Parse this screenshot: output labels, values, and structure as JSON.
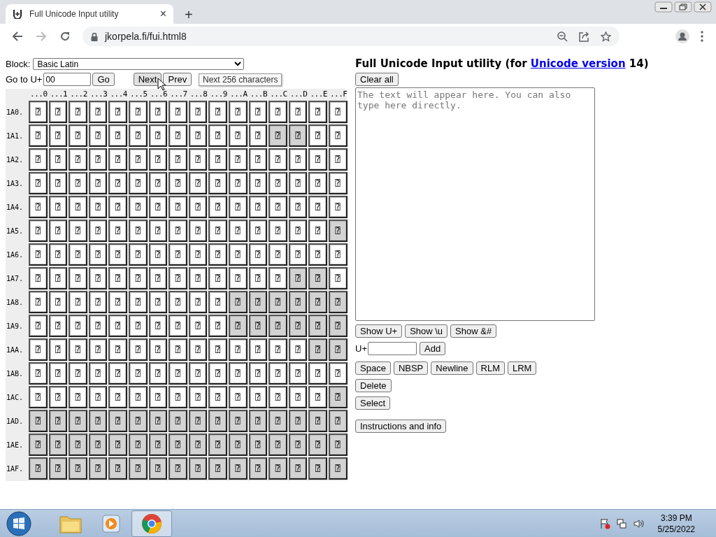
{
  "browser": {
    "tab_title": "Full Unicode Input utility",
    "tab_close": "×",
    "new_tab": "+",
    "url": "jkorpela.fi/fui.html8"
  },
  "controls": {
    "block_label": "Block:",
    "block_value": "Basic Latin",
    "goto_label": "Go to U+",
    "goto_value": "00",
    "buttons": [
      {
        "label": "Go",
        "hovered": false
      },
      {
        "label": "Next",
        "hovered": true
      },
      {
        "label": "Prev",
        "hovered": false
      }
    ],
    "tooltip": "Next 256 characters"
  },
  "grid": {
    "columns": [
      "...0",
      "...1",
      "...2",
      "...3",
      "...4",
      "...5",
      "...6",
      "...7",
      "...8",
      "...9",
      "...A",
      "...B",
      "...C",
      "...D",
      "...E",
      "...F"
    ],
    "rows": [
      {
        "label": "1A0.",
        "cells": [
          {
            "glyph": "⍰",
            "assigned": true
          },
          {
            "glyph": "⍰",
            "assigned": true
          },
          {
            "glyph": "⍰",
            "assigned": true
          },
          {
            "glyph": "⍰",
            "assigned": true
          },
          {
            "glyph": "⍰",
            "assigned": true
          },
          {
            "glyph": "⍰",
            "assigned": true
          },
          {
            "glyph": "⍰",
            "assigned": true
          },
          {
            "glyph": "⍰",
            "assigned": true
          },
          {
            "glyph": "⍰",
            "assigned": true
          },
          {
            "glyph": "⍰",
            "assigned": true
          },
          {
            "glyph": "⍰",
            "assigned": true
          },
          {
            "glyph": "⍰",
            "assigned": true
          },
          {
            "glyph": "⍰",
            "assigned": true
          },
          {
            "glyph": "⍰",
            "assigned": true
          },
          {
            "glyph": "⍰",
            "assigned": true
          },
          {
            "glyph": "⍰",
            "assigned": true
          }
        ]
      },
      {
        "label": "1A1.",
        "cells": [
          {
            "glyph": "⍰",
            "assigned": true
          },
          {
            "glyph": "⍰",
            "assigned": true
          },
          {
            "glyph": "⍰",
            "assigned": true
          },
          {
            "glyph": "⍰",
            "assigned": true
          },
          {
            "glyph": "⍰",
            "assigned": true
          },
          {
            "glyph": "⍰",
            "assigned": true
          },
          {
            "glyph": "⍰",
            "assigned": true
          },
          {
            "glyph": "⍰",
            "assigned": true
          },
          {
            "glyph": "⍰",
            "assigned": true
          },
          {
            "glyph": "⍰",
            "assigned": true
          },
          {
            "glyph": "⍰",
            "assigned": true
          },
          {
            "glyph": "⍰",
            "assigned": true
          },
          {
            "glyph": "⍰",
            "assigned": false
          },
          {
            "glyph": "⍰",
            "assigned": false
          },
          {
            "glyph": "⍰",
            "assigned": true
          },
          {
            "glyph": "⍰",
            "assigned": true
          }
        ]
      },
      {
        "label": "1A2.",
        "cells": [
          {
            "glyph": "⍰",
            "assigned": true
          },
          {
            "glyph": "⍰",
            "assigned": true
          },
          {
            "glyph": "⍰",
            "assigned": true
          },
          {
            "glyph": "⍰",
            "assigned": true
          },
          {
            "glyph": "⍰",
            "assigned": true
          },
          {
            "glyph": "⍰",
            "assigned": true
          },
          {
            "glyph": "⍰",
            "assigned": true
          },
          {
            "glyph": "⍰",
            "assigned": true
          },
          {
            "glyph": "⍰",
            "assigned": true
          },
          {
            "glyph": "⍰",
            "assigned": true
          },
          {
            "glyph": "⍰",
            "assigned": true
          },
          {
            "glyph": "⍰",
            "assigned": true
          },
          {
            "glyph": "⍰",
            "assigned": true
          },
          {
            "glyph": "⍰",
            "assigned": true
          },
          {
            "glyph": "⍰",
            "assigned": true
          },
          {
            "glyph": "⍰",
            "assigned": true
          }
        ]
      },
      {
        "label": "1A3.",
        "cells": [
          {
            "glyph": "⍰",
            "assigned": true
          },
          {
            "glyph": "⍰",
            "assigned": true
          },
          {
            "glyph": "⍰",
            "assigned": true
          },
          {
            "glyph": "⍰",
            "assigned": true
          },
          {
            "glyph": "⍰",
            "assigned": true
          },
          {
            "glyph": "⍰",
            "assigned": true
          },
          {
            "glyph": "⍰",
            "assigned": true
          },
          {
            "glyph": "⍰",
            "assigned": true
          },
          {
            "glyph": "⍰",
            "assigned": true
          },
          {
            "glyph": "⍰",
            "assigned": true
          },
          {
            "glyph": "⍰",
            "assigned": true
          },
          {
            "glyph": "⍰",
            "assigned": true
          },
          {
            "glyph": "⍰",
            "assigned": true
          },
          {
            "glyph": "⍰",
            "assigned": true
          },
          {
            "glyph": "⍰",
            "assigned": true
          },
          {
            "glyph": "⍰",
            "assigned": true
          }
        ]
      },
      {
        "label": "1A4.",
        "cells": [
          {
            "glyph": "⍰",
            "assigned": true
          },
          {
            "glyph": "⍰",
            "assigned": true
          },
          {
            "glyph": "⍰",
            "assigned": true
          },
          {
            "glyph": "⍰",
            "assigned": true
          },
          {
            "glyph": "⍰",
            "assigned": true
          },
          {
            "glyph": "⍰",
            "assigned": true
          },
          {
            "glyph": "⍰",
            "assigned": true
          },
          {
            "glyph": "⍰",
            "assigned": true
          },
          {
            "glyph": "⍰",
            "assigned": true
          },
          {
            "glyph": "⍰",
            "assigned": true
          },
          {
            "glyph": "⍰",
            "assigned": true
          },
          {
            "glyph": "⍰",
            "assigned": true
          },
          {
            "glyph": "⍰",
            "assigned": true
          },
          {
            "glyph": "⍰",
            "assigned": true
          },
          {
            "glyph": "⍰",
            "assigned": true
          },
          {
            "glyph": "⍰",
            "assigned": true
          }
        ]
      },
      {
        "label": "1A5.",
        "cells": [
          {
            "glyph": "⍰",
            "assigned": true
          },
          {
            "glyph": "⍰",
            "assigned": true
          },
          {
            "glyph": "⍰",
            "assigned": true
          },
          {
            "glyph": "⍰",
            "assigned": true
          },
          {
            "glyph": "⍰",
            "assigned": true
          },
          {
            "glyph": "⍰",
            "assigned": true
          },
          {
            "glyph": "⍰",
            "assigned": true
          },
          {
            "glyph": "⍰",
            "assigned": true
          },
          {
            "glyph": "⍰",
            "assigned": true
          },
          {
            "glyph": "⍰",
            "assigned": true
          },
          {
            "glyph": "⍰",
            "assigned": true
          },
          {
            "glyph": "⍰",
            "assigned": true
          },
          {
            "glyph": "⍰",
            "assigned": true
          },
          {
            "glyph": "⍰",
            "assigned": true
          },
          {
            "glyph": "⍰",
            "assigned": true
          },
          {
            "glyph": "⍰",
            "assigned": false
          }
        ]
      },
      {
        "label": "1A6.",
        "cells": [
          {
            "glyph": "⍰",
            "assigned": true
          },
          {
            "glyph": "⍰",
            "assigned": true
          },
          {
            "glyph": "⍰",
            "assigned": true
          },
          {
            "glyph": "⍰",
            "assigned": true
          },
          {
            "glyph": "⍰",
            "assigned": true
          },
          {
            "glyph": "⍰",
            "assigned": true
          },
          {
            "glyph": "⍰",
            "assigned": true
          },
          {
            "glyph": "⍰",
            "assigned": true
          },
          {
            "glyph": "⍰",
            "assigned": true
          },
          {
            "glyph": "⍰",
            "assigned": true
          },
          {
            "glyph": "⍰",
            "assigned": true
          },
          {
            "glyph": "⍰",
            "assigned": true
          },
          {
            "glyph": "⍰",
            "assigned": true
          },
          {
            "glyph": "⍰",
            "assigned": true
          },
          {
            "glyph": "⍰",
            "assigned": true
          },
          {
            "glyph": "⍰",
            "assigned": true
          }
        ]
      },
      {
        "label": "1A7.",
        "cells": [
          {
            "glyph": "⍰",
            "assigned": true
          },
          {
            "glyph": "⍰",
            "assigned": true
          },
          {
            "glyph": "⍰",
            "assigned": true
          },
          {
            "glyph": "⍰",
            "assigned": true
          },
          {
            "glyph": "⍰",
            "assigned": true
          },
          {
            "glyph": "⍰",
            "assigned": true
          },
          {
            "glyph": "⍰",
            "assigned": true
          },
          {
            "glyph": "⍰",
            "assigned": true
          },
          {
            "glyph": "⍰",
            "assigned": true
          },
          {
            "glyph": "⍰",
            "assigned": true
          },
          {
            "glyph": "⍰",
            "assigned": true
          },
          {
            "glyph": "⍰",
            "assigned": true
          },
          {
            "glyph": "⍰",
            "assigned": true
          },
          {
            "glyph": "⍰",
            "assigned": false
          },
          {
            "glyph": "⍰",
            "assigned": false
          },
          {
            "glyph": "⍰",
            "assigned": true
          }
        ]
      },
      {
        "label": "1A8.",
        "cells": [
          {
            "glyph": "⍰",
            "assigned": true
          },
          {
            "glyph": "⍰",
            "assigned": true
          },
          {
            "glyph": "⍰",
            "assigned": true
          },
          {
            "glyph": "⍰",
            "assigned": true
          },
          {
            "glyph": "⍰",
            "assigned": true
          },
          {
            "glyph": "⍰",
            "assigned": true
          },
          {
            "glyph": "⍰",
            "assigned": true
          },
          {
            "glyph": "⍰",
            "assigned": true
          },
          {
            "glyph": "⍰",
            "assigned": true
          },
          {
            "glyph": "⍰",
            "assigned": true
          },
          {
            "glyph": "⍰",
            "assigned": false
          },
          {
            "glyph": "⍰",
            "assigned": false
          },
          {
            "glyph": "⍰",
            "assigned": false
          },
          {
            "glyph": "⍰",
            "assigned": false
          },
          {
            "glyph": "⍰",
            "assigned": false
          },
          {
            "glyph": "⍰",
            "assigned": false
          }
        ]
      },
      {
        "label": "1A9.",
        "cells": [
          {
            "glyph": "⍰",
            "assigned": true
          },
          {
            "glyph": "⍰",
            "assigned": true
          },
          {
            "glyph": "⍰",
            "assigned": true
          },
          {
            "glyph": "⍰",
            "assigned": true
          },
          {
            "glyph": "⍰",
            "assigned": true
          },
          {
            "glyph": "⍰",
            "assigned": true
          },
          {
            "glyph": "⍰",
            "assigned": true
          },
          {
            "glyph": "⍰",
            "assigned": true
          },
          {
            "glyph": "⍰",
            "assigned": true
          },
          {
            "glyph": "⍰",
            "assigned": true
          },
          {
            "glyph": "⍰",
            "assigned": false
          },
          {
            "glyph": "⍰",
            "assigned": false
          },
          {
            "glyph": "⍰",
            "assigned": false
          },
          {
            "glyph": "⍰",
            "assigned": false
          },
          {
            "glyph": "⍰",
            "assigned": false
          },
          {
            "glyph": "⍰",
            "assigned": false
          }
        ]
      },
      {
        "label": "1AA.",
        "cells": [
          {
            "glyph": "⍰",
            "assigned": true
          },
          {
            "glyph": "⍰",
            "assigned": true
          },
          {
            "glyph": "⍰",
            "assigned": true
          },
          {
            "glyph": "⍰",
            "assigned": true
          },
          {
            "glyph": "⍰",
            "assigned": true
          },
          {
            "glyph": "⍰",
            "assigned": true
          },
          {
            "glyph": "⍰",
            "assigned": true
          },
          {
            "glyph": "⍰",
            "assigned": true
          },
          {
            "glyph": "⍰",
            "assigned": true
          },
          {
            "glyph": "⍰",
            "assigned": true
          },
          {
            "glyph": "⍰",
            "assigned": true
          },
          {
            "glyph": "⍰",
            "assigned": true
          },
          {
            "glyph": "⍰",
            "assigned": true
          },
          {
            "glyph": "⍰",
            "assigned": true
          },
          {
            "glyph": "⍰",
            "assigned": false
          },
          {
            "glyph": "⍰",
            "assigned": false
          }
        ]
      },
      {
        "label": "1AB.",
        "cells": [
          {
            "glyph": "⍰",
            "assigned": true
          },
          {
            "glyph": "⍰",
            "assigned": true
          },
          {
            "glyph": "⍰",
            "assigned": true
          },
          {
            "glyph": "⍰",
            "assigned": true
          },
          {
            "glyph": "⍰",
            "assigned": true
          },
          {
            "glyph": "⍰",
            "assigned": true
          },
          {
            "glyph": "⍰",
            "assigned": true
          },
          {
            "glyph": "⍰",
            "assigned": true
          },
          {
            "glyph": "⍰",
            "assigned": true
          },
          {
            "glyph": "⍰",
            "assigned": true
          },
          {
            "glyph": "⍰",
            "assigned": true
          },
          {
            "glyph": "⍰",
            "assigned": true
          },
          {
            "glyph": "⍰",
            "assigned": true
          },
          {
            "glyph": "⍰",
            "assigned": true
          },
          {
            "glyph": "⍰",
            "assigned": true
          },
          {
            "glyph": "⍰",
            "assigned": true
          }
        ]
      },
      {
        "label": "1AC.",
        "cells": [
          {
            "glyph": "⍰",
            "assigned": true
          },
          {
            "glyph": "⍰",
            "assigned": true
          },
          {
            "glyph": "⍰",
            "assigned": true
          },
          {
            "glyph": "⍰",
            "assigned": true
          },
          {
            "glyph": "⍰",
            "assigned": true
          },
          {
            "glyph": "⍰",
            "assigned": true
          },
          {
            "glyph": "⍰",
            "assigned": true
          },
          {
            "glyph": "⍰",
            "assigned": true
          },
          {
            "glyph": "⍰",
            "assigned": true
          },
          {
            "glyph": "⍰",
            "assigned": true
          },
          {
            "glyph": "⍰",
            "assigned": true
          },
          {
            "glyph": "⍰",
            "assigned": true
          },
          {
            "glyph": "⍰",
            "assigned": true
          },
          {
            "glyph": "⍰",
            "assigned": true
          },
          {
            "glyph": "⍰",
            "assigned": true
          },
          {
            "glyph": "⍰",
            "assigned": false
          }
        ]
      },
      {
        "label": "1AD.",
        "cells": [
          {
            "glyph": "⍰",
            "assigned": false
          },
          {
            "glyph": "⍰",
            "assigned": false
          },
          {
            "glyph": "⍰",
            "assigned": false
          },
          {
            "glyph": "⍰",
            "assigned": false
          },
          {
            "glyph": "⍰",
            "assigned": false
          },
          {
            "glyph": "⍰",
            "assigned": false
          },
          {
            "glyph": "⍰",
            "assigned": false
          },
          {
            "glyph": "⍰",
            "assigned": false
          },
          {
            "glyph": "⍰",
            "assigned": false
          },
          {
            "glyph": "⍰",
            "assigned": false
          },
          {
            "glyph": "⍰",
            "assigned": false
          },
          {
            "glyph": "⍰",
            "assigned": false
          },
          {
            "glyph": "⍰",
            "assigned": false
          },
          {
            "glyph": "⍰",
            "assigned": false
          },
          {
            "glyph": "⍰",
            "assigned": false
          },
          {
            "glyph": "⍰",
            "assigned": false
          }
        ]
      },
      {
        "label": "1AE.",
        "cells": [
          {
            "glyph": "⍰",
            "assigned": false
          },
          {
            "glyph": "⍰",
            "assigned": false
          },
          {
            "glyph": "⍰",
            "assigned": false
          },
          {
            "glyph": "⍰",
            "assigned": false
          },
          {
            "glyph": "⍰",
            "assigned": false
          },
          {
            "glyph": "⍰",
            "assigned": false
          },
          {
            "glyph": "⍰",
            "assigned": false
          },
          {
            "glyph": "⍰",
            "assigned": false
          },
          {
            "glyph": "⍰",
            "assigned": false
          },
          {
            "glyph": "⍰",
            "assigned": false
          },
          {
            "glyph": "⍰",
            "assigned": false
          },
          {
            "glyph": "⍰",
            "assigned": false
          },
          {
            "glyph": "⍰",
            "assigned": false
          },
          {
            "glyph": "⍰",
            "assigned": false
          },
          {
            "glyph": "⍰",
            "assigned": false
          },
          {
            "glyph": "⍰",
            "assigned": false
          }
        ]
      },
      {
        "label": "1AF.",
        "cells": [
          {
            "glyph": "⍰",
            "assigned": false
          },
          {
            "glyph": "⍰",
            "assigned": false
          },
          {
            "glyph": "⍰",
            "assigned": false
          },
          {
            "glyph": "⍰",
            "assigned": false
          },
          {
            "glyph": "⍰",
            "assigned": false
          },
          {
            "glyph": "⍰",
            "assigned": false
          },
          {
            "glyph": "⍰",
            "assigned": false
          },
          {
            "glyph": "⍰",
            "assigned": false
          },
          {
            "glyph": "⍰",
            "assigned": false
          },
          {
            "glyph": "⍰",
            "assigned": false
          },
          {
            "glyph": "⍰",
            "assigned": false
          },
          {
            "glyph": "⍰",
            "assigned": false
          },
          {
            "glyph": "⍰",
            "assigned": false
          },
          {
            "glyph": "⍰",
            "assigned": false
          },
          {
            "glyph": "⍰",
            "assigned": false
          },
          {
            "glyph": "⍰",
            "assigned": false
          }
        ]
      }
    ]
  },
  "editor": {
    "title_prefix": "Full Unicode Input utility (for",
    "link": "Unicode version",
    "title_suffix": "14)",
    "clear_button": "Clear all",
    "placeholder": "The text will appear here. You can also type here directly.",
    "show_buttons": [
      "Show U+",
      "Show \\u",
      "Show &#"
    ],
    "add_label": "U+",
    "add_button": "Add",
    "insert_buttons": [
      "Space",
      "NBSP",
      "Newline",
      "RLM",
      "LRM"
    ],
    "delete_button": "Delete",
    "select_button": "Select",
    "info_button": "Instructions and info"
  },
  "taskbar": {
    "time": "3:39 PM",
    "date": "5/25/2022"
  }
}
